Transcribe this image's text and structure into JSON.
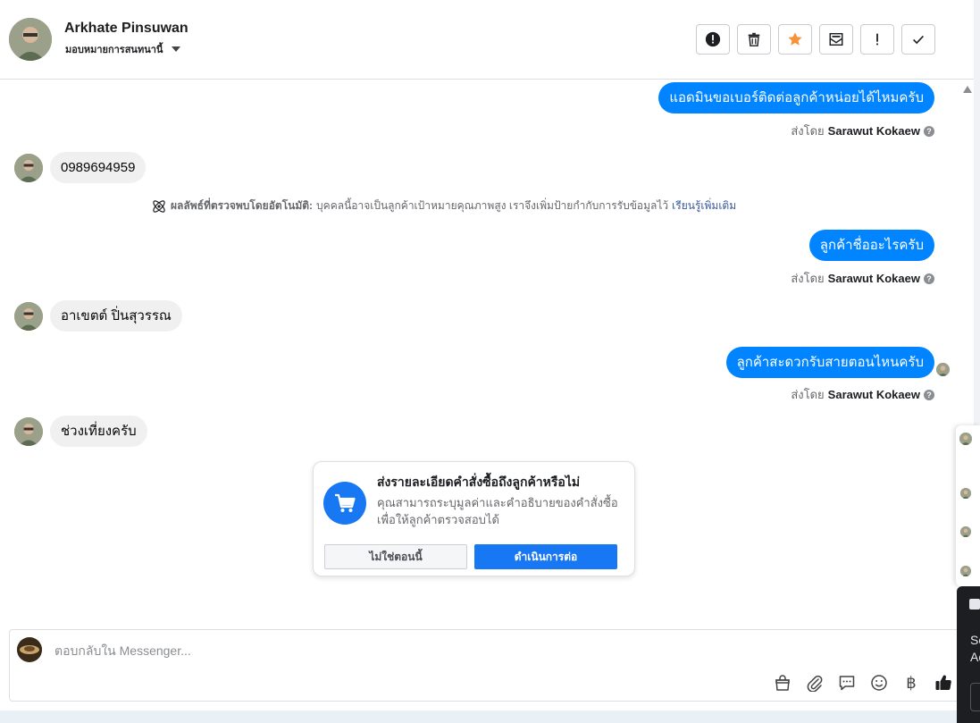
{
  "header": {
    "name": "Arkhate Pinsuwan",
    "assign_label": "มอบหมายการสนทนานี้",
    "actions": [
      {
        "name": "spam-button",
        "icon": "alert-circle-icon"
      },
      {
        "name": "delete-button",
        "icon": "trash-icon"
      },
      {
        "name": "star-button",
        "icon": "star-icon"
      },
      {
        "name": "mark-unread-button",
        "icon": "mail-icon"
      },
      {
        "name": "follow-up-button",
        "icon": "exclamation-icon"
      },
      {
        "name": "done-button",
        "icon": "check-icon"
      }
    ]
  },
  "messages": {
    "out1": "แอดมินขอเบอร์ติดต่อลูกค้าหน่อยได้ไหมครับ",
    "in1": "0989694959",
    "ai_note_bold": "ผลลัพธ์ที่ตรวจพบโดยอัตโนมัติ:",
    "ai_note_text": "บุคคลนี้อาจเป็นลูกค้าเป้าหมายคุณภาพสูง เราจึงเพิ่มป้ายกำกับการรับข้อมูลไว้",
    "ai_note_link": "เรียนรู้เพิ่มเติม",
    "out2": "ลูกค้าชื่ออะไรครับ",
    "in2": "อาเขตต์ ปิ่นสุวรรณ",
    "out3": "ลูกค้าสะดวกรับสายตอนไหนครับ",
    "in3": "ช่วงเที่ยงครับ",
    "sent_by_prefix": "ส่งโดย",
    "sent_by_name": "Sarawut Kokaew"
  },
  "order_card": {
    "title": "ส่งรายละเอียดคำสั่งซื้อถึงลูกค้าหรือไม่",
    "description": "คุณสามารถระบุมูลค่าและคำอธิบายของคำสั่งซื้อเพื่อให้ลูกค้าตรวจสอบได้",
    "not_now": "ไม่ใช่ตอนนี้",
    "continue": "ดำเนินการต่อ"
  },
  "composer": {
    "placeholder": "ตอบกลับใน Messenger...",
    "tools": [
      "bag-icon",
      "paperclip-icon",
      "saved-reply-icon",
      "emoji-icon",
      "baht-icon",
      "thumbs-up-icon"
    ],
    "baht_symbol": "฿"
  },
  "overlay": {
    "dark_line1": "Sc",
    "dark_line2": "Ac"
  }
}
